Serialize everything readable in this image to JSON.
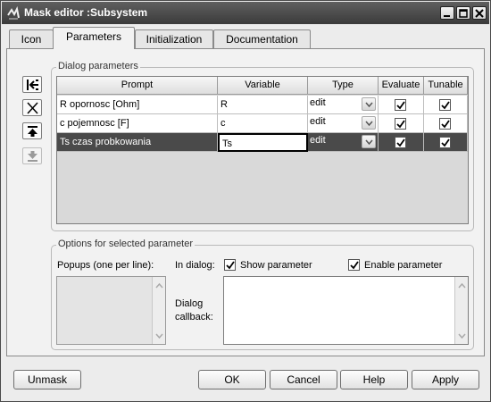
{
  "window": {
    "title": "Mask editor :Subsystem"
  },
  "tabs": [
    {
      "label": "Icon"
    },
    {
      "label": "Parameters"
    },
    {
      "label": "Initialization"
    },
    {
      "label": "Documentation"
    }
  ],
  "dialog_parameters": {
    "group_label": "Dialog parameters",
    "columns": [
      "Prompt",
      "Variable",
      "Type",
      "Evaluate",
      "Tunable"
    ],
    "rows": [
      {
        "prompt": "R opornosc [Ohm]",
        "variable": "R",
        "type": "edit",
        "evaluate": true,
        "tunable": true
      },
      {
        "prompt": "c pojemnosc [F]",
        "variable": "c",
        "type": "edit",
        "evaluate": true,
        "tunable": true
      },
      {
        "prompt": "Ts czas probkowania",
        "variable": "Ts",
        "type": "edit",
        "evaluate": true,
        "tunable": true
      }
    ],
    "selected_row": 2
  },
  "options": {
    "group_label": "Options for selected parameter",
    "popups_label": "Popups (one per line):",
    "in_dialog_label": "In dialog:",
    "show_parameter_label": "Show parameter",
    "show_parameter_checked": true,
    "enable_parameter_label": "Enable parameter",
    "enable_parameter_checked": true,
    "dialog_callback_label_line1": "Dialog",
    "dialog_callback_label_line2": "callback:"
  },
  "buttons": {
    "unmask": "Unmask",
    "ok": "OK",
    "cancel": "Cancel",
    "help": "Help",
    "apply": "Apply"
  },
  "icons": {
    "app": "mask-editor-icon",
    "side": [
      "add-parameter-icon",
      "delete-parameter-icon",
      "move-up-icon",
      "move-down-icon"
    ]
  }
}
